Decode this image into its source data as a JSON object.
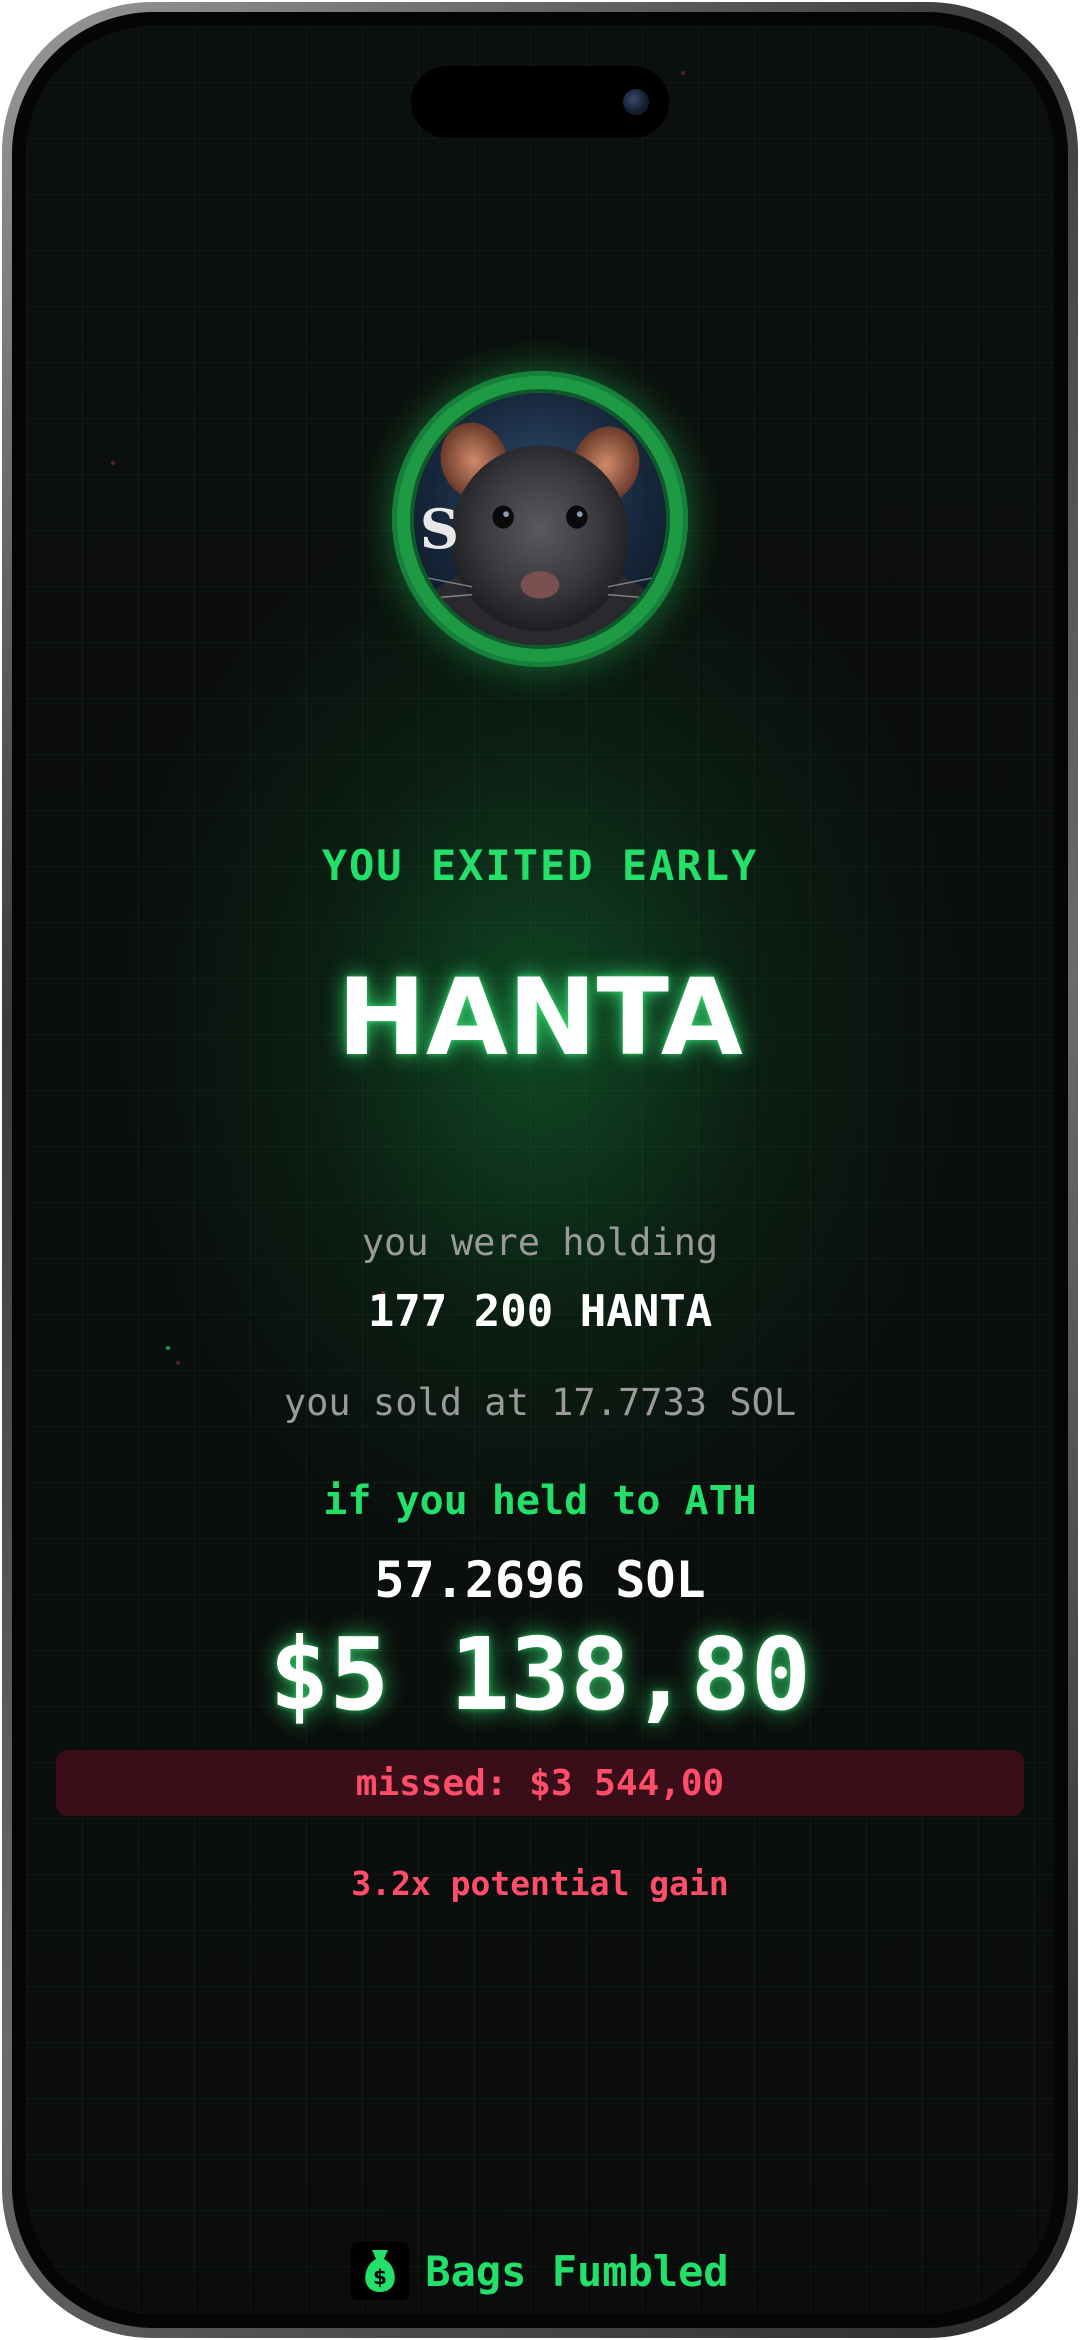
{
  "token": {
    "name": "HANTA"
  },
  "status": {
    "headline": "YOU EXITED EARLY"
  },
  "holding": {
    "label": "you were holding",
    "value": "177 200 HANTA"
  },
  "sold": {
    "text": "you sold at 17.7733 SOL"
  },
  "ath": {
    "label": "if you held to ATH",
    "sol_value": "57.2696 SOL",
    "usd_value": "$5 138,80"
  },
  "missed": {
    "text": "missed: $3 544,00"
  },
  "gain": {
    "text": "3.2x potential gain"
  },
  "brand": {
    "name": "Bags Fumbled",
    "icon": "money-bag-icon"
  },
  "colors": {
    "accent_green": "#22e06a",
    "loss_red": "#ff4d6a",
    "background": "#0a0d0c"
  }
}
